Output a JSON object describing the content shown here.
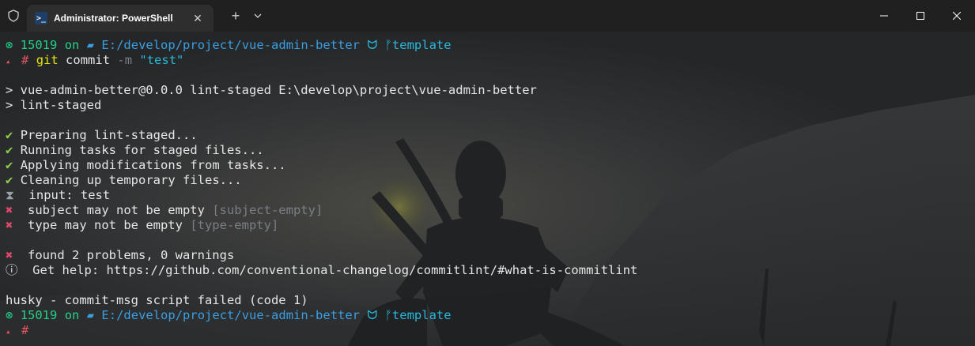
{
  "window": {
    "tab_title": "Administrator: PowerShell",
    "tab_icon_glyph": ">_",
    "new_tab": "+",
    "controls": {
      "minimize": "minimize-icon",
      "maximize": "maximize-icon",
      "close": "close-icon"
    }
  },
  "prompt1": {
    "indicator": "⊗",
    "user": "15019",
    "on": "on",
    "folder_glyph": "▰",
    "path": "E:/develop/project/vue-admin-better",
    "git_glyph": "ᗢ",
    "branch_glyph": "ᚠ",
    "branch": "template",
    "marker": "▴",
    "hash": "#",
    "cmd": "git",
    "arg1": "commit",
    "flag": "-m",
    "msg": "\"test\""
  },
  "output": {
    "npm1": "> vue-admin-better@0.0.0 lint-staged E:\\develop\\project\\vue-admin-better",
    "npm2": "> lint-staged",
    "check": "✔",
    "steps": [
      "Preparing lint-staged...",
      "Running tasks for staged files...",
      "Applying modifications from tasks...",
      "Cleaning up temporary files..."
    ],
    "hourglass": "⧗",
    "input_line": "  input: test",
    "cross": "✖",
    "subject_text": "  subject may not be empty ",
    "subject_rule": "[subject-empty]",
    "type_text": "  type may not be empty ",
    "type_rule": "[type-empty]",
    "found_text": "  found 2 problems, 0 warnings",
    "info": "ⓘ",
    "help_text": "  Get help: https://github.com/conventional-changelog/commitlint/#what-is-commitlint",
    "husky": "husky - commit-msg script failed (code 1)"
  },
  "prompt2": {
    "indicator": "⊗",
    "user": "15019",
    "on": "on",
    "folder_glyph": "▰",
    "path": "E:/develop/project/vue-admin-better",
    "git_glyph": "ᗢ",
    "branch_glyph": "ᚠ",
    "branch": "template",
    "marker": "▴",
    "hash": "#"
  }
}
